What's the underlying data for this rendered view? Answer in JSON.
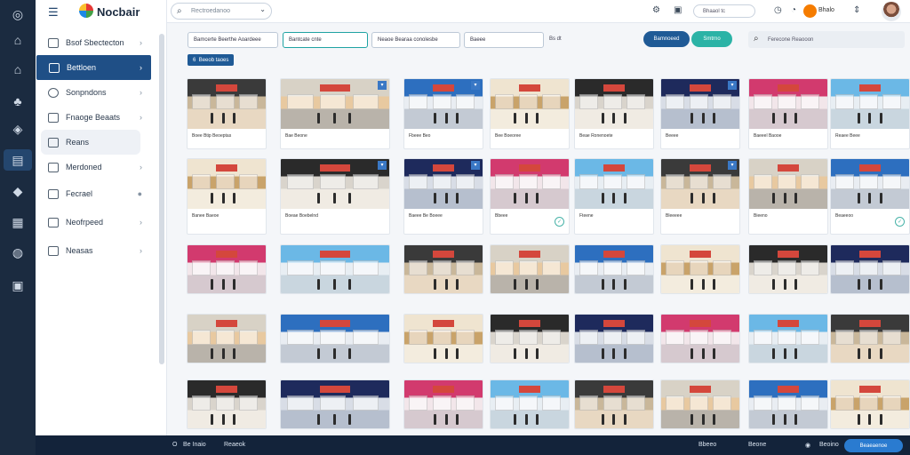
{
  "app": {
    "name": "Nocbair"
  },
  "rail": {
    "icons": [
      "wifi-icon",
      "home-icon",
      "house-icon",
      "tree-icon",
      "location-icon",
      "store-icon",
      "shield-icon",
      "building-icon",
      "globe-icon",
      "box-icon"
    ]
  },
  "sidebar": {
    "items": [
      {
        "label": "Bsof Sbectecton"
      },
      {
        "label": "Bettloen"
      },
      {
        "label": "Sonpndons"
      },
      {
        "label": "Fnaoge Beaats"
      },
      {
        "label": "Reans"
      },
      {
        "label": "Merdoned"
      },
      {
        "label": "Fecrael"
      },
      {
        "label": "Neofrpeed"
      },
      {
        "label": "Neasas"
      }
    ]
  },
  "topbar": {
    "search_placeholder": "Rectroedanoo",
    "status_text": "Bhaaol tc",
    "account_label": "Bhalo"
  },
  "toolbar": {
    "filters": [
      "Bamcerte Beerthe Aoardeee",
      "Bantcate cnte",
      "Neaoe Bearaa conolesbe",
      "Baeee",
      "Bs dt"
    ],
    "pill_primary": "Bamnoeed",
    "pill_secondary": "Smtrno",
    "search_placeholder": "Ferecone Reaooon",
    "count_badge": "6",
    "count_label": "Beeob taoes"
  },
  "grid": {
    "rows": [
      [
        "Boee Btip Beoeptas",
        "Bae Beone",
        "Fbeee Beo",
        "Bee Boeoree",
        "Beae Ronenoete",
        "Beeee",
        "Baeeel Baooe",
        "Reaee Beee"
      ],
      [
        "Banee Baeoe",
        "Boeae Boebelnd",
        "Baeee Be Boeee",
        "Bbeee",
        "Fteene",
        "Bleeeee",
        "Bieeno",
        "Beaeeoo"
      ],
      [
        "",
        "",
        "",
        "",
        "",
        "",
        "",
        ""
      ],
      [
        "",
        "",
        "",
        "",
        "",
        "",
        "",
        ""
      ],
      [
        "",
        "",
        "",
        "",
        "",
        "",
        "",
        ""
      ]
    ]
  },
  "bottombar": {
    "status_left": "Be Inaio",
    "status_mid": "Reaeok",
    "status_right_1": "Bbeeo",
    "status_right_2": "Beone",
    "status_right_3": "Beoino",
    "action_label": "Beaeaenoe"
  }
}
